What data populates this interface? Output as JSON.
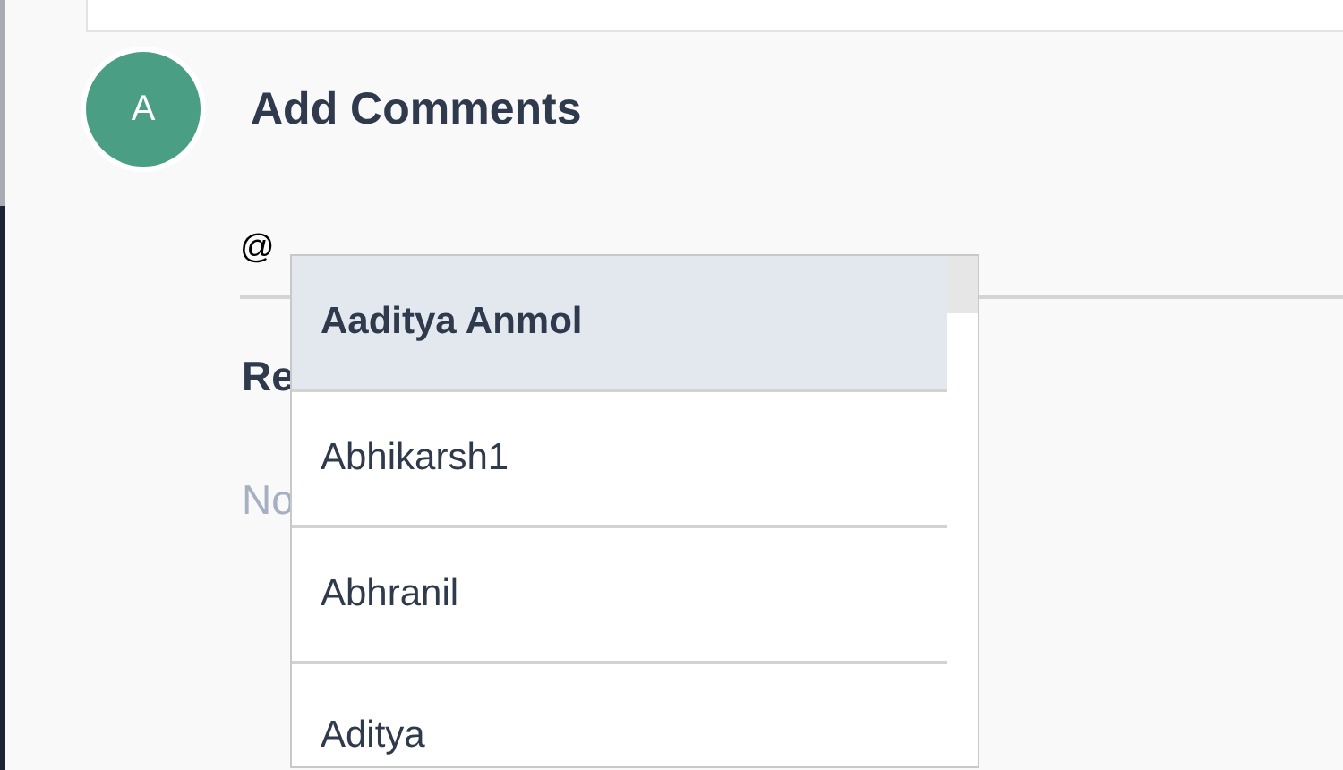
{
  "avatar": {
    "initial": "A",
    "color": "#4a9e84"
  },
  "add_comments": {
    "title": "Add Comments",
    "input_value": "@"
  },
  "section": {
    "heading": "Re",
    "empty_text": "No"
  },
  "mention_dropdown": {
    "items": [
      {
        "label": "Aaditya Anmol",
        "selected": true
      },
      {
        "label": "Abhikarsh1",
        "selected": false
      },
      {
        "label": "Abhranil",
        "selected": false
      },
      {
        "label": "Aditya",
        "selected": false
      }
    ]
  }
}
